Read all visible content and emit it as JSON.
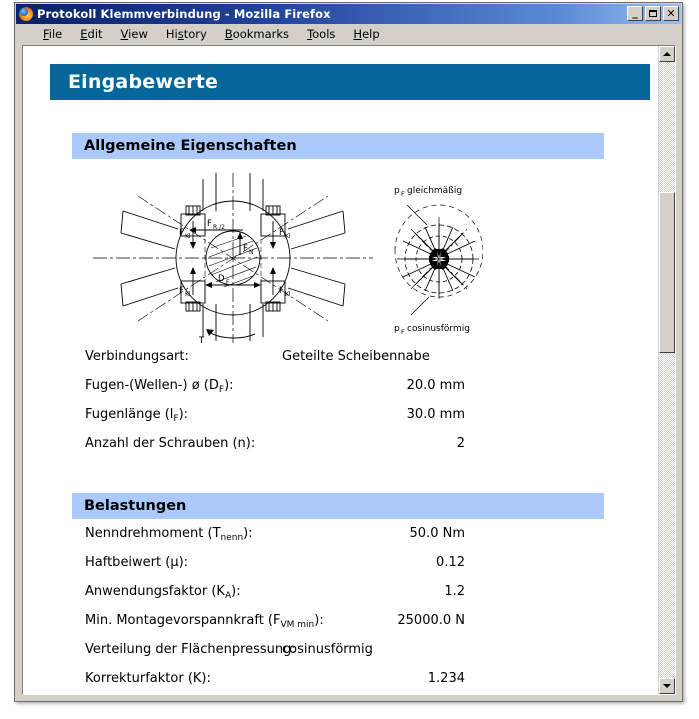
{
  "window": {
    "title": "Protokoll Klemmverbindung - Mozilla Firefox",
    "icon": "firefox-logo-icon",
    "buttons": {
      "minimize": "_",
      "maximize": "maximize-glyph",
      "close": "✕"
    }
  },
  "menubar": {
    "items": [
      {
        "label": "File",
        "accel": "F"
      },
      {
        "label": "Edit",
        "accel": "E"
      },
      {
        "label": "View",
        "accel": "V"
      },
      {
        "label": "History",
        "accel": "s"
      },
      {
        "label": "Bookmarks",
        "accel": "B"
      },
      {
        "label": "Tools",
        "accel": "T"
      },
      {
        "label": "Help",
        "accel": "H"
      }
    ]
  },
  "scrollbar": {
    "up_arrow": "scroll-up-icon",
    "down_arrow": "scroll-down-icon",
    "thumb": "scroll-thumb"
  },
  "document": {
    "banner_title": "Eingabewerte",
    "colors": {
      "banner_bg": "#046699",
      "subhead_bg": "#abcafb",
      "titlebar_bg": "#0a246a",
      "chrome_bg": "#d4d0c8"
    },
    "sections": [
      {
        "id": "allgemein",
        "heading": "Allgemeine Eigenschaften",
        "rows": [
          {
            "label": "Verbindungsart:",
            "value": "Geteilte Scheibennabe",
            "align": "left"
          },
          {
            "label_main": "Fugen-(Wellen-) ø  (D",
            "label_sub": "F",
            "label_tail": "):",
            "value": "20.0 mm",
            "align": "right"
          },
          {
            "label_main": "Fugenlänge  (l",
            "label_sub": "F",
            "label_tail": "):",
            "value": "30.0 mm",
            "align": "right"
          },
          {
            "label": "Anzahl der Schrauben  (n):",
            "value": "2",
            "align": "right"
          }
        ]
      },
      {
        "id": "belastungen",
        "heading": "Belastungen",
        "rows": [
          {
            "label_main": "Nenndrehmoment (T",
            "label_sub": "nenn",
            "label_tail": "):",
            "value": "50.0 Nm",
            "align": "right"
          },
          {
            "label": "Haftbeiwert (µ):",
            "value": "0.12",
            "align": "right"
          },
          {
            "label_main": "Anwendungsfaktor (K",
            "label_sub": "A",
            "label_tail": "):",
            "value": "1.2",
            "align": "right"
          },
          {
            "label_main": "Min. Montagevorspannkraft (F",
            "label_sub": "VM min",
            "label_tail": "):",
            "value": "25000.0 N",
            "align": "right"
          },
          {
            "label": "Verteilung der Flächenpressung:",
            "value": "cosinusförmig",
            "align": "left"
          },
          {
            "label": "Korrekturfaktor (K):",
            "value": "1.234",
            "align": "right"
          }
        ]
      }
    ],
    "figures": {
      "clamp_diagram": {
        "name": "split-hub-clamp-diagram",
        "labels": [
          "F",
          "Kl",
          "F",
          "R /2",
          "F",
          "N",
          "D",
          "F",
          "T"
        ]
      },
      "pressure_diagram": {
        "name": "surface-pressure-distribution-diagram",
        "label_top_main": "p",
        "label_top_sub": "F",
        "label_top_tail": " gleichmäßig",
        "label_bottom_main": "p",
        "label_bottom_sub": "F",
        "label_bottom_tail": " cosinusförmig"
      }
    }
  }
}
